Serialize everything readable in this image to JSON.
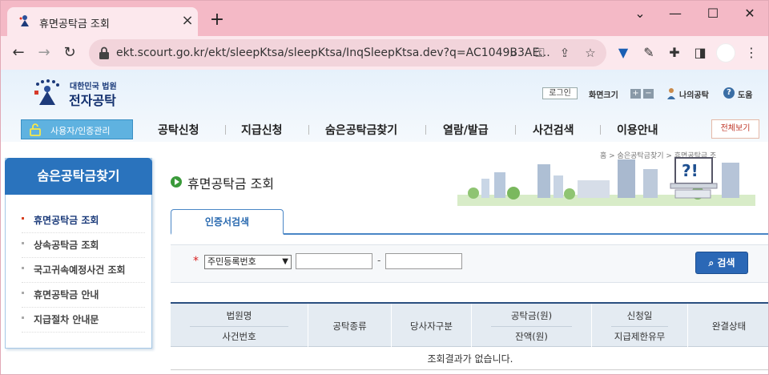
{
  "browser": {
    "tab_title": "휴면공탁금 조회",
    "url": "ekt.scourt.go.kr/ekt/sleepKtsa/sleepKtsa/InqSleepKtsa.dev?q=AC1049B3AE..."
  },
  "header": {
    "logo_sub": "대한민국 법원",
    "logo_main": "전자공탁",
    "login": "로그인",
    "zoom": "화면크기",
    "zoom_in": "+",
    "zoom_out": "−",
    "my": "나의공탁",
    "help": "도움"
  },
  "gnb": {
    "user": "사용자/인증관리",
    "items": [
      "공탁신청",
      "지급신청",
      "숨은공탁금찾기",
      "열람/발급",
      "사건검색",
      "이용안내"
    ],
    "all_view": "전체보기"
  },
  "breadcrumb": "홈 > 숨은공탁금찾기 > 휴면공탁금 조",
  "lnb": {
    "title": "숨은공탁금찾기",
    "items": [
      "휴면공탁금 조회",
      "상속공탁금 조회",
      "국고귀속예정사건 조회",
      "휴면공탁금 안내",
      "지급절차 안내문"
    ]
  },
  "main": {
    "title": "휴면공탁금 조회",
    "tab": "인증서검색",
    "required_mark": "*",
    "id_type": "주민등록번호",
    "dash": "-",
    "search_btn": "검색",
    "columns": [
      {
        "top": "법원명",
        "bottom": "사건번호"
      },
      {
        "label": "공탁종류"
      },
      {
        "label": "당사자구분"
      },
      {
        "top": "공탁금(원)",
        "bottom": "잔액(원)"
      },
      {
        "top": "신청일",
        "bottom": "지급제한유무"
      },
      {
        "label": "완결상태"
      }
    ],
    "empty": "조회결과가 없습니다."
  },
  "colors": {
    "brand": "#2a73bd",
    "tab_strip": "#f4b9c6",
    "toolbar": "#fce8ed"
  }
}
